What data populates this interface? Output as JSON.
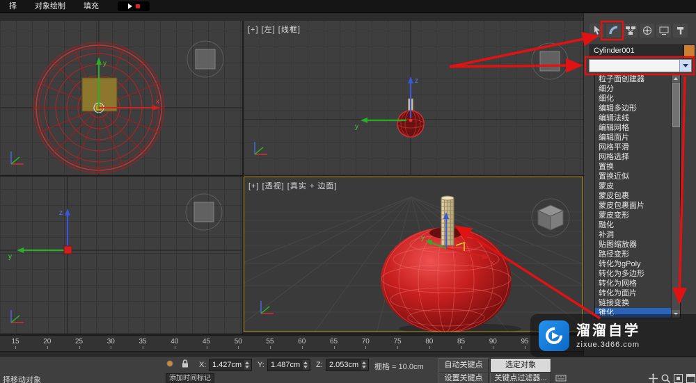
{
  "menu_bar": {
    "items": [
      "择",
      "对象绘制",
      "填充"
    ]
  },
  "viewports": {
    "left": {
      "label": "[+] [左] [线框]"
    },
    "perspective": {
      "label": "[+] [透视] [真实 + 边面]"
    },
    "axes": {
      "x": "x",
      "y": "y",
      "z": "z"
    }
  },
  "command_panel": {
    "tab_icons": [
      "create-tab-icon",
      "modify-tab-icon",
      "hierarchy-tab-icon",
      "motion-tab-icon",
      "display-tab-icon",
      "utilities-tab-icon"
    ],
    "object_name": "Cylinder001",
    "object_color": "#cd7f32",
    "modifier_list": [
      "粒子面创建器",
      "细分",
      "细化",
      "编辑多边形",
      "编辑法线",
      "编辑网格",
      "编辑面片",
      "网格平滑",
      "网格选择",
      "置换",
      "置换近似",
      "蒙皮",
      "蒙皮包裹",
      "蒙皮包裹面片",
      "蒙皮变形",
      "融化",
      "补洞",
      "贴图缩放器",
      "路径变形",
      "转化为gPoly",
      "转化为多边形",
      "转化为网格",
      "转化为面片",
      "链接变换",
      "锥化"
    ],
    "selected_modifier": "锥化"
  },
  "timeline": {
    "ticks": [
      "15",
      "20",
      "25",
      "30",
      "35",
      "40",
      "45",
      "50",
      "55",
      "60",
      "65",
      "70",
      "75",
      "80",
      "85",
      "90",
      "95"
    ]
  },
  "status_bar": {
    "x_label": "X:",
    "x_value": "1.427cm",
    "y_label": "Y:",
    "y_value": "1.487cm",
    "z_label": "Z:",
    "z_value": "2.053cm",
    "grid_label": "栅格 = 10.0cm",
    "auto_key_label": "自动关键点",
    "selected_filter_label": "选定对象",
    "set_key_label": "设置关键点",
    "key_filters_label": "关键点过滤器...",
    "add_time_tag_label": "添加时间标记",
    "prompt": "择移动对象"
  },
  "watermark": {
    "title": "溜溜自学",
    "site": "zixue.3d66.com"
  },
  "annotations": {
    "arrow_color": "#e01212"
  }
}
